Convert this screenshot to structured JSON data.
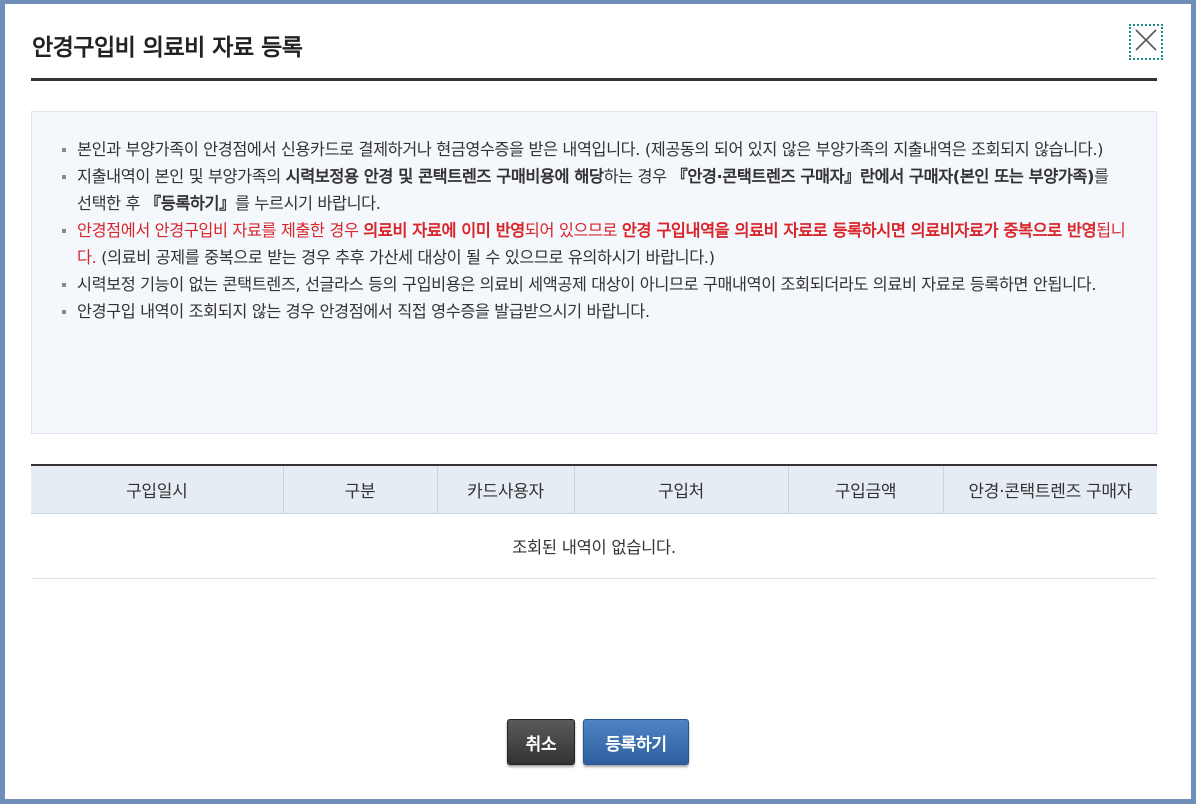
{
  "dialog": {
    "title": "안경구입비 의료비 자료 등록",
    "close_icon": "close-icon"
  },
  "notice": {
    "items": [
      {
        "parts": [
          {
            "text": "본인과 부양가족이 안경점에서 신용카드로 결제하거나 현금영수증을 받은 내역입니다. (제공동의 되어 있지 않은 부양가족의 지출내역은 조회되지 않습니다.)",
            "style": "normal"
          }
        ]
      },
      {
        "parts": [
          {
            "text": "지출내역이 본인 및 부양가족의 ",
            "style": "normal"
          },
          {
            "text": "시력보정용 안경 및 콘택트렌즈 구매비용에 해당",
            "style": "strong"
          },
          {
            "text": "하는 경우 ",
            "style": "normal"
          },
          {
            "text": "『안경·콘택트렌즈 구매자』란에서 구매자(본인 또는 부양가족)",
            "style": "strong"
          },
          {
            "text": "를 선택한 후 ",
            "style": "normal"
          },
          {
            "text": "『등록하기』",
            "style": "strong"
          },
          {
            "text": "를 누르시기 바랍니다.",
            "style": "normal"
          }
        ]
      },
      {
        "parts": [
          {
            "text": "안경점에서 안경구입비 자료를 제출한 경우 ",
            "style": "red"
          },
          {
            "text": "의료비 자료에 이미 반영",
            "style": "red-strong"
          },
          {
            "text": "되어 있으므로 ",
            "style": "red"
          },
          {
            "text": "안경 구입내역을 의료비 자료로 등록하시면 의료비자료가 중복으로 반영",
            "style": "red-strong"
          },
          {
            "text": "됩니다.",
            "style": "red"
          },
          {
            "text": " (의료비 공제를 중복으로 받는 경우 추후 가산세 대상이 될 수 있으므로 유의하시기 바랍니다.)",
            "style": "normal"
          }
        ]
      },
      {
        "parts": [
          {
            "text": "시력보정 기능이 없는 콘택트렌즈, 선글라스 등의 구입비용은 의료비 세액공제 대상이 아니므로 구매내역이 조회되더라도 의료비 자료로 등록하면 안됩니다.",
            "style": "normal"
          }
        ]
      },
      {
        "parts": [
          {
            "text": "안경구입 내역이 조회되지 않는 경우 안경점에서 직접 영수증을 발급받으시기 바랍니다.",
            "style": "normal"
          }
        ]
      }
    ]
  },
  "table": {
    "columns": [
      "구입일시",
      "구분",
      "카드사용자",
      "구입처",
      "구입금액",
      "안경·콘택트렌즈 구매자"
    ],
    "empty_message": "조회된 내역이 없습니다."
  },
  "buttons": {
    "cancel": "취소",
    "register": "등록하기"
  },
  "colors": {
    "accent": "#3a6fb0",
    "warning": "#d8262b",
    "frame": "#6f8fb8"
  }
}
